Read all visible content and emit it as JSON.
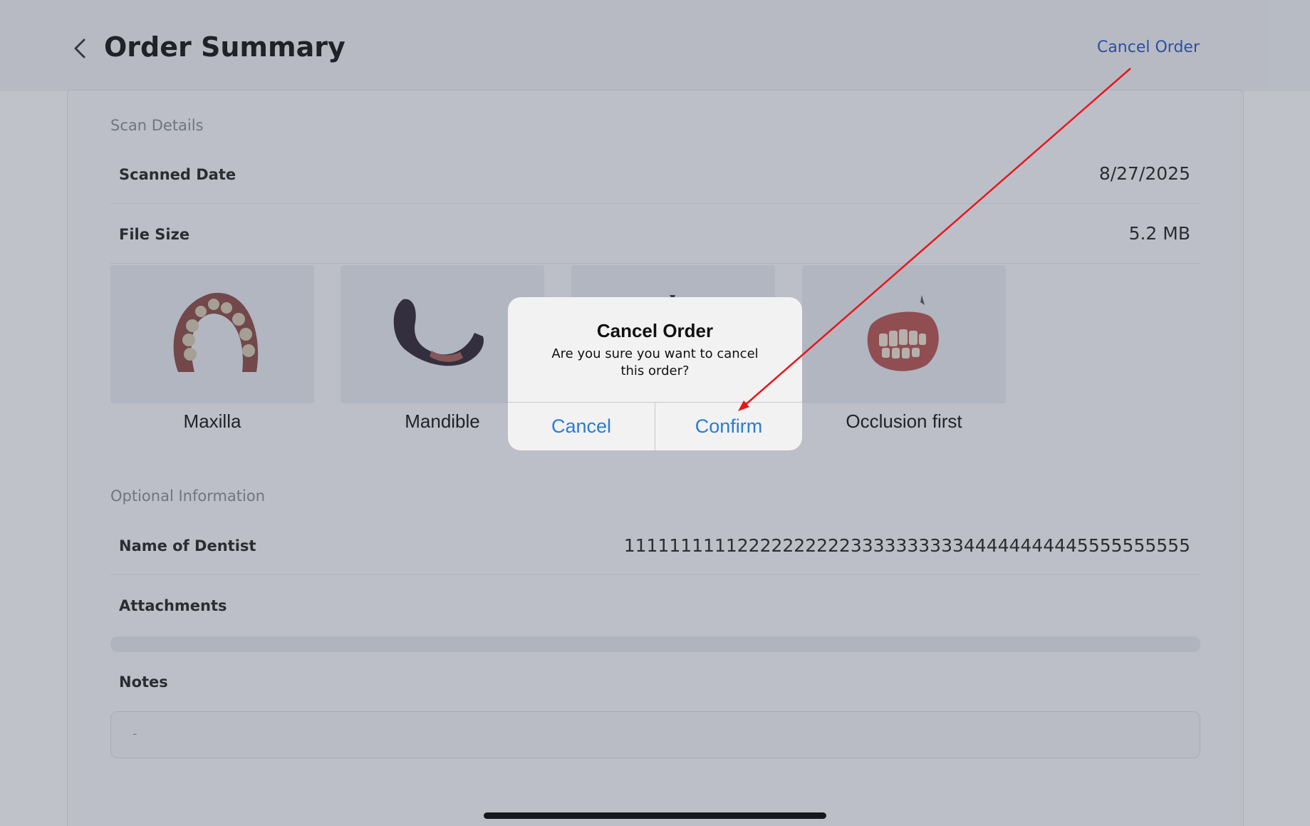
{
  "header": {
    "title": "Order Summary",
    "cancel_order_label": "Cancel Order"
  },
  "scan_details": {
    "section_label": "Scan Details",
    "rows": [
      {
        "label": "Scanned Date",
        "value": "8/27/2025"
      },
      {
        "label": "File Size",
        "value": "5.2 MB"
      }
    ],
    "thumbnails": [
      {
        "label": "Maxilla"
      },
      {
        "label": "Mandible"
      },
      {
        "label": ""
      },
      {
        "label": "Occlusion first"
      }
    ]
  },
  "optional_information": {
    "section_label": "Optional Information",
    "dentist_label": "Name of Dentist",
    "dentist_value": "11111111112222222222333333333344444444445555555555",
    "attachments_label": "Attachments",
    "notes_label": "Notes",
    "notes_value": "-"
  },
  "alert": {
    "title": "Cancel Order",
    "message": "Are you sure you want to cancel this order?",
    "cancel_label": "Cancel",
    "confirm_label": "Confirm",
    "button_color": "#2a7bd6"
  },
  "annotation": {
    "arrow_color": "#e8161b"
  },
  "colors": {
    "link": "#1d56c9",
    "overlay": "rgba(60,70,90,0.33)"
  }
}
